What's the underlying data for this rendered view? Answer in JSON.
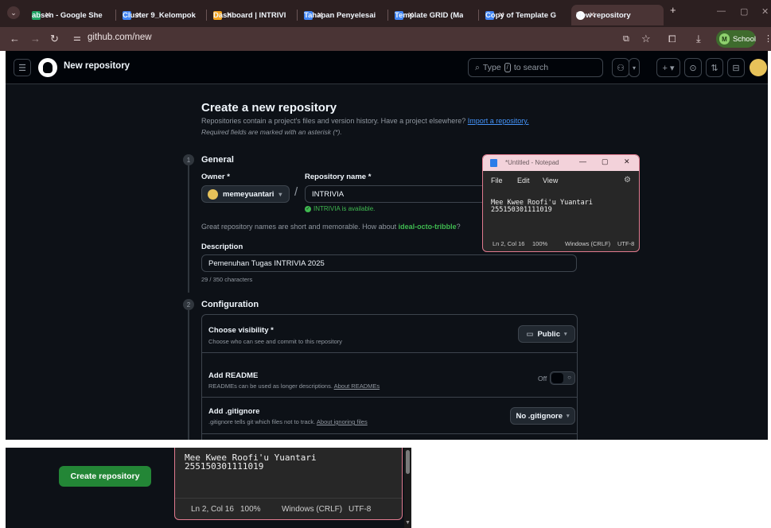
{
  "browser": {
    "tabs": [
      {
        "label": "absen - Google She",
        "favicon_color": "#1fa463"
      },
      {
        "label": "Cluster 9_Kelompok",
        "favicon_color": "#4285f4"
      },
      {
        "label": "Dashboard | INTRIVI",
        "favicon_color": "#f5a623"
      },
      {
        "label": "Tahapan Penyelesai",
        "favicon_color": "#4285f4"
      },
      {
        "label": "Template GRID (Ma",
        "favicon_color": "#4285f4"
      },
      {
        "label": "Copy of Template G",
        "favicon_color": "#4285f4"
      },
      {
        "label": "New repository",
        "favicon_color": "#ffffff"
      }
    ],
    "url": "github.com/new",
    "profile_initial": "M",
    "profile_label": "School"
  },
  "github": {
    "header_title": "New repository",
    "search_prefix": "Type",
    "search_key": "/",
    "search_suffix": "to search",
    "page_title": "Create a new repository",
    "subtitle_text": "Repositories contain a project's files and version history. Have a project elsewhere?",
    "import_link": "Import a repository.",
    "required_note": "Required fields are marked with an asterisk (*).",
    "step1_number": "1",
    "step1_title": "General",
    "owner_label": "Owner *",
    "owner_value": "memeyuantari",
    "repo_label": "Repository name *",
    "repo_value": "INTRIVIA",
    "availability": "INTRIVIA is available.",
    "suggestion_text": "Great repository names are short and memorable. How about",
    "suggestion_name": "ideal-octo-tribble",
    "suggestion_end": "?",
    "description_label": "Description",
    "description_value": "Pemenuhan Tugas INTRIVIA 2025",
    "char_count": "29 / 350 characters",
    "step2_number": "2",
    "step2_title": "Configuration",
    "visibility_title": "Choose visibility *",
    "visibility_desc": "Choose who can see and commit to this repository",
    "visibility_value": "Public",
    "readme_title": "Add README",
    "readme_desc": "READMEs can be used as longer descriptions.",
    "readme_link": "About READMEs",
    "readme_toggle": "Off",
    "gitignore_title": "Add .gitignore",
    "gitignore_desc": ".gitignore tells git which files not to track.",
    "gitignore_link": "About ignoring files",
    "gitignore_value": "No .gitignore",
    "create_button": "Create repository"
  },
  "notepad": {
    "title": "*Untitled - Notepad",
    "menu": [
      "File",
      "Edit",
      "View"
    ],
    "line1": "Mee Kwee Roofi'u Yuantari",
    "line2": "255150301111019",
    "status_pos": "Ln 2, Col 16",
    "status_zoom": "100%",
    "status_eol": "Windows (CRLF)",
    "status_enc": "UTF-8"
  }
}
